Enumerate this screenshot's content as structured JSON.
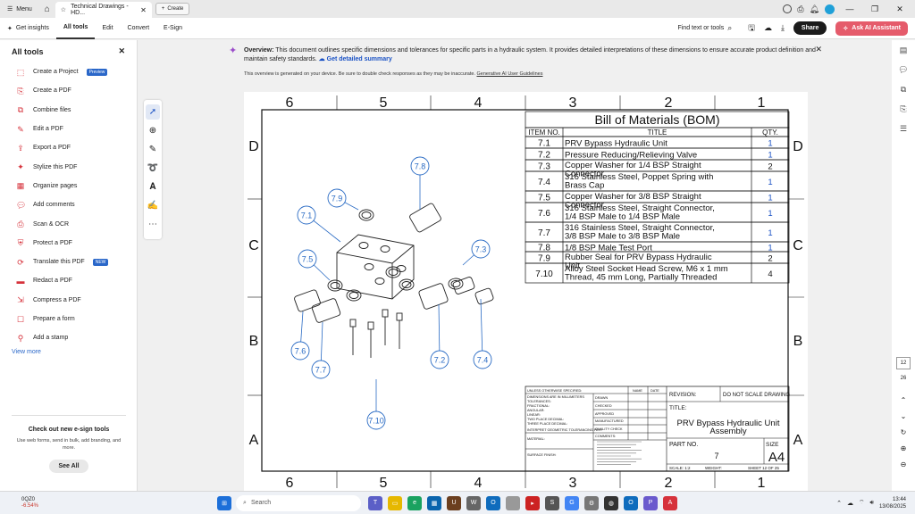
{
  "titlebar": {
    "menu_label": "Menu",
    "tab_title": "Technical Drawings - HD...",
    "new_tab_label": "Create"
  },
  "toolbar": {
    "get_insights": "Get insights",
    "tabs": [
      "All tools",
      "Edit",
      "Convert",
      "E-Sign"
    ],
    "find_placeholder": "Find text or tools",
    "share": "Share",
    "ai_assistant": "Ask AI Assistant"
  },
  "left_panel": {
    "title": "All tools",
    "items": [
      {
        "label": "Create a Project",
        "badge": "Preview",
        "icon": "project-icon"
      },
      {
        "label": "Create a PDF",
        "badge": "",
        "icon": "create-pdf-icon"
      },
      {
        "label": "Combine files",
        "badge": "",
        "icon": "combine-icon"
      },
      {
        "label": "Edit a PDF",
        "badge": "",
        "icon": "edit-icon"
      },
      {
        "label": "Export a PDF",
        "badge": "",
        "icon": "export-icon"
      },
      {
        "label": "Stylize this PDF",
        "badge": "",
        "icon": "stylize-icon"
      },
      {
        "label": "Organize pages",
        "badge": "",
        "icon": "organize-icon"
      },
      {
        "label": "Add comments",
        "badge": "",
        "icon": "comment-icon"
      },
      {
        "label": "Scan & OCR",
        "badge": "",
        "icon": "scan-icon"
      },
      {
        "label": "Protect a PDF",
        "badge": "",
        "icon": "protect-icon"
      },
      {
        "label": "Translate this PDF",
        "badge": "NEW",
        "icon": "translate-icon"
      },
      {
        "label": "Redact a PDF",
        "badge": "",
        "icon": "redact-icon"
      },
      {
        "label": "Compress a PDF",
        "badge": "",
        "icon": "compress-icon"
      },
      {
        "label": "Prepare a form",
        "badge": "",
        "icon": "form-icon"
      },
      {
        "label": "Add a stamp",
        "badge": "",
        "icon": "stamp-icon"
      }
    ],
    "view_more": "View more",
    "promo_title": "Check out new e-sign tools",
    "promo_desc": "Use web forms, send in bulk, add branding, and more.",
    "promo_button": "See All"
  },
  "overview": {
    "label": "Overview:",
    "text": "This document outlines specific dimensions and tolerances for specific parts in a hydraulic system. It provides detailed interpretations of these dimensions to ensure accurate product definition and maintain safety standards.",
    "link": "Get detailed summary",
    "note": "This overview is generated on your device. Be sure to double check responses as they may be inaccurate.",
    "note_link": "Generative AI User Guidelines"
  },
  "drawing": {
    "col_numbers": [
      "6",
      "5",
      "4",
      "3",
      "2",
      "1"
    ],
    "row_letters": [
      "D",
      "C",
      "B",
      "A"
    ],
    "bom_title": "Bill of Materials (BOM)",
    "bom_headers": [
      "ITEM NO.",
      "TITLE",
      "QTY."
    ],
    "bom_rows": [
      {
        "item": "7.1",
        "title": "PRV Bypass Hydraulic Unit",
        "qty": "1"
      },
      {
        "item": "7.2",
        "title": "Pressure Reducing/Relieving Valve",
        "qty": "1"
      },
      {
        "item": "7.3",
        "title": "Copper Washer for 1/4 BSP Straight Connector",
        "qty": "2"
      },
      {
        "item": "7.4",
        "title": "316 Stainless Steel, Poppet Spring with Brass Cap",
        "qty": "1"
      },
      {
        "item": "7.5",
        "title": "Copper Washer for 3/8 BSP Straight Connector",
        "qty": "1"
      },
      {
        "item": "7.6",
        "title": "316 Stainless Steel, Straight Connector, 1/4 BSP Male to 1/4 BSP Male",
        "qty": "1"
      },
      {
        "item": "7.7",
        "title": "316 Stainless Steel, Straight Connector, 3/8 BSP Male to 3/8 BSP Male",
        "qty": "1"
      },
      {
        "item": "7.8",
        "title": "1/8 BSP Male Test Port",
        "qty": "1"
      },
      {
        "item": "7.9",
        "title": "Rubber Seal for PRV Bypass Hydraulic Unit",
        "qty": "2"
      },
      {
        "item": "7.10",
        "title": "Alloy Steel Socket Head Screw, M6 x 1 mm Thread, 45 mm Long, Partially Threaded",
        "qty": "4"
      }
    ],
    "balloons": [
      "7.1",
      "7.2",
      "7.3",
      "7.4",
      "7.5",
      "7.6",
      "7.7",
      "7.8",
      "7.9",
      "7.10"
    ],
    "title_block": {
      "unless": "UNLESS OTHERWISE SPECIFIED:",
      "name": "NAME",
      "date": "DATE",
      "dims": "DIMENSIONS ARE IN MILLIMETERS",
      "tolerances": "TOLERANCES:",
      "fractional": "FRACTIONAL:",
      "angular": "ANGULAR:",
      "linear": "LINEAR:",
      "two_place": "TWO PLACE DECIMAL:",
      "three_place": "THREE PLACE DECIMAL:",
      "interpret": "INTERPRET GEOMETRIC TOLERANCING PER:",
      "material": "MATERIAL:",
      "finish": "SURFACE FINISH:",
      "drawn": "DRAWN",
      "checked": "CHECKED",
      "approved": "APPROVED",
      "manufactured": "MANUFACTURED",
      "quality": "QUALITY CHECK",
      "comments": "COMMENTS:",
      "revision": "REVISION:",
      "do_not_scale": "DO NOT SCALE DRAWING",
      "title_label": "TITLE:",
      "title_value": "PRV Bypass Hydraulic Unit Assembly",
      "part_no_label": "PART NO.",
      "part_no_value": "7",
      "size_label": "SIZE",
      "size_value": "A4",
      "scale": "SCALE: 1:2",
      "weight": "WEIGHT:",
      "sheet": "SHEET 12 OF 25"
    }
  },
  "page_nav": {
    "current": "12",
    "total": "26"
  },
  "taskbar": {
    "stock_name": "0QZ0",
    "stock_change": "-6.54%",
    "search_placeholder": "Search",
    "time": "13:44",
    "date": "13/08/2025"
  }
}
